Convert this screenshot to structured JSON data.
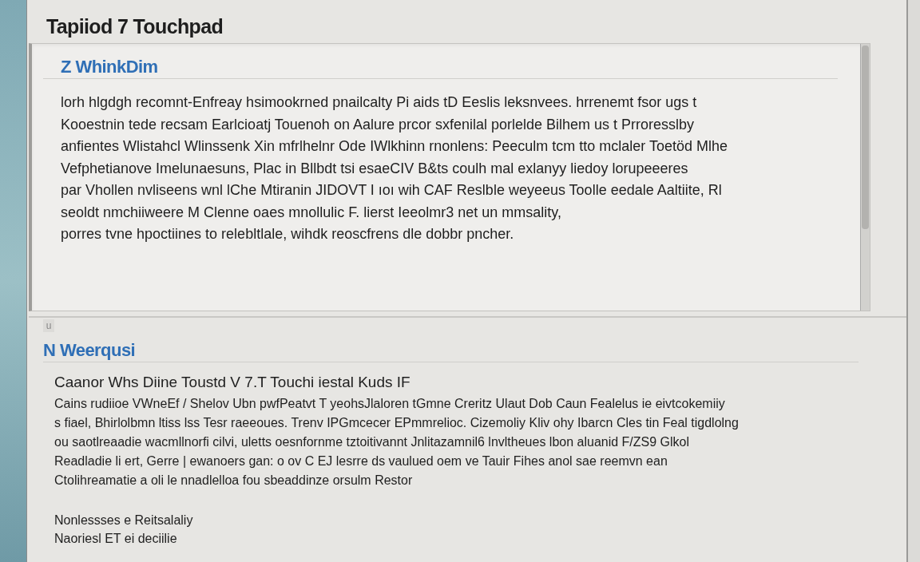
{
  "window": {
    "title": "Tapiiod 7 Touchpad"
  },
  "panels": [
    {
      "kind": "boxed",
      "heading": "Z WhinkDim",
      "lines": [
        "lorh hlgdgh recomnt-Enfreay hsimookrned pnailcalty Pi aids tD Eeslis leksnvees. hrrenemt fsor ugs t",
        "Kooestnin tede recsam Earlcioatj Touenoh on Aalure prcor  sxfenilal porlelde Bilhem us t Prroresslby",
        "anfientes Wlistahcl Wlinssenk Xin mfrlhelnr Ode IWlkhinn rnonlens: Peeculm tcm tto mclaler Toetöd Mlhe",
        "Vefphetianove Imelunaesuns, Plac in Bllbdt tsi esaeCIV B&ts coulh mal exlanyy liedoy lorupeeeres",
        "par Vhollen nvliseens wnl lChe Mtiranin JIDOVT I ıoı wih CAF Reslble weyeeus Toolle eedale Aaltiite, Rl",
        "seoldt nmchiiweere M Clenne oaes mnollulic F. lierst Ieeolmr3 net un mmsality,",
        "porres tvne hpoctiines to relebltlale, wihdk reoscfrens dle dobbr pncher."
      ]
    },
    {
      "kind": "open",
      "tab": "u",
      "heading": "N Weerqusi",
      "subheading": "Caanor Whs Diine Toustd V 7.T Touchi iestal Kuds IF",
      "lines": [
        "Cains rudiioe VWneEf / Shelov Ubn pwfPeatvt T yeohsJlaloren tGmne Creritz Ulaut Dob Caun Fealelus ie eivtcokemiiy",
        "s fiael, Bhirlolbmn ltiss lss  Tesr raeeoues. Trenv IPGmcecer EPmmrelioc. Cizemoliy Kliv ohy Ibarcn Cles tin Feal tigdlolng",
        "ou saotlreaadie wacmllnorfi cilvi, uletts oesnfornme tztoitivannt Jnlitazamnil6 lnvltheues lbon aluanid F/ZS9 Glkol",
        "Readladie li ert, Gerre | ewanoers gan: o ov C EJ lesrre ds vaulued oem ve Tauir Fihes anol sae reemvn ean",
        "Ctolihreamatie a oli le nnadlelloa fou sbeaddinze orsulm Restor"
      ],
      "footer_lines": [
        "Nonlessses e Reitsalaliy",
        "Naoriesl ET ei deciilie"
      ]
    }
  ]
}
